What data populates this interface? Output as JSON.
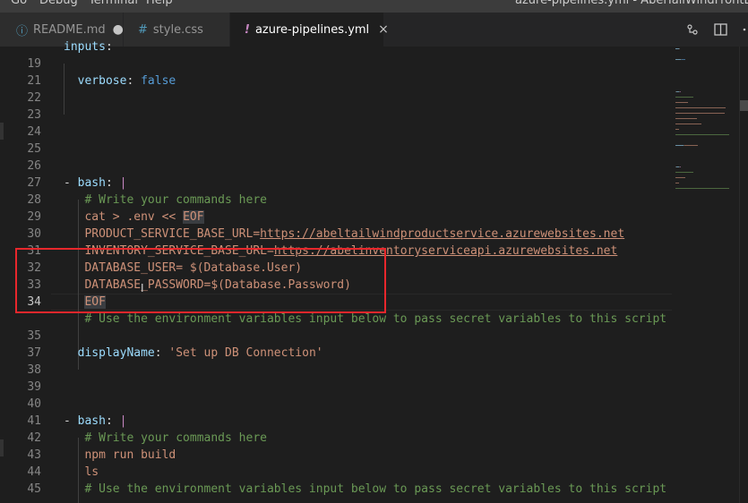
{
  "menu": [
    "Go",
    "Debug",
    "Terminal",
    "Help"
  ],
  "window_title": "azure-pipelines.yml - AbelTailWindFrontEnd - Visual",
  "tabs": [
    {
      "label": "README.md",
      "icon": "info-icon",
      "modified": true,
      "active": false
    },
    {
      "label": "style.css",
      "icon": "hash-icon",
      "active": false
    },
    {
      "label": "azure-pipelines.yml",
      "icon": "exclamation-icon",
      "active": true
    }
  ],
  "tab_close_glyph": "×",
  "tab_dot_glyph": "●",
  "editor": {
    "current_line": 34,
    "lines": [
      {
        "num": "",
        "segs": [
          [
            "inputs",
            "k"
          ],
          [
            ":",
            "p"
          ]
        ]
      },
      {
        "num": "19",
        "segs": []
      },
      {
        "num": "21",
        "segs": [
          [
            "  verbose",
            "k"
          ],
          [
            ": ",
            "p"
          ],
          [
            "false",
            "kw"
          ]
        ]
      },
      {
        "num": "22",
        "segs": []
      },
      {
        "num": "23",
        "segs": []
      },
      {
        "num": "24",
        "segs": []
      },
      {
        "num": "25",
        "segs": []
      },
      {
        "num": "26",
        "segs": []
      },
      {
        "num": "27",
        "segs": [
          [
            "- ",
            "p"
          ],
          [
            "bash",
            "k"
          ],
          [
            ": ",
            "p"
          ],
          [
            "|",
            "pipe"
          ]
        ]
      },
      {
        "num": "28",
        "segs": [
          [
            "   # Write your commands here",
            "c"
          ]
        ]
      },
      {
        "num": "29",
        "segs": [
          [
            "   cat > .env << ",
            "s"
          ],
          [
            "EOF",
            "s eofbox"
          ]
        ]
      },
      {
        "num": "30",
        "segs": [
          [
            "   PRODUCT_SERVICE_BASE_URL=",
            "s"
          ],
          [
            "https://abeltailwindproductservice.azurewebsites.net",
            "s u"
          ]
        ]
      },
      {
        "num": "31",
        "segs": [
          [
            "   INVENTORY_SERVICE_BASE_URL=",
            "s"
          ],
          [
            "https://abelinventoryserviceapi.azurewebsites.net",
            "s u"
          ]
        ]
      },
      {
        "num": "32",
        "segs": [
          [
            "   DATABASE_USER= $(Database.User)",
            "s"
          ]
        ]
      },
      {
        "num": "33",
        "segs": [
          [
            "   DATABASE_PASSWORD=$(Database.Password)",
            "s"
          ]
        ]
      },
      {
        "num": "34",
        "segs": [
          [
            "   ",
            "s"
          ],
          [
            "EOF",
            "s eofbox"
          ]
        ]
      },
      {
        "num": "",
        "segs": [
          [
            "   # Use the environment variables input below to pass secret variables to this script",
            "c"
          ]
        ]
      },
      {
        "num": "35",
        "segs": []
      },
      {
        "num": "37",
        "segs": [
          [
            "  displayName",
            "k"
          ],
          [
            ": ",
            "p"
          ],
          [
            "'Set up DB Connection'",
            "s"
          ]
        ]
      },
      {
        "num": "38",
        "segs": []
      },
      {
        "num": "39",
        "segs": []
      },
      {
        "num": "40",
        "segs": []
      },
      {
        "num": "41",
        "segs": [
          [
            "- ",
            "p"
          ],
          [
            "bash",
            "k"
          ],
          [
            ": ",
            "p"
          ],
          [
            "|",
            "pipe"
          ]
        ]
      },
      {
        "num": "42",
        "segs": [
          [
            "   # Write your commands here",
            "c"
          ]
        ]
      },
      {
        "num": "43",
        "segs": [
          [
            "   npm run build",
            "s"
          ]
        ]
      },
      {
        "num": "44",
        "segs": [
          [
            "   ls",
            "s"
          ]
        ]
      },
      {
        "num": "45",
        "segs": [
          [
            "   # Use the environment variables input below to pass secret variables to this script",
            "c"
          ]
        ]
      }
    ]
  },
  "colors": {
    "highlight_box": "#e8272c",
    "background": "#1e1e1e",
    "comment": "#6a9955",
    "string": "#ce9178",
    "key": "#9cdcfe"
  }
}
